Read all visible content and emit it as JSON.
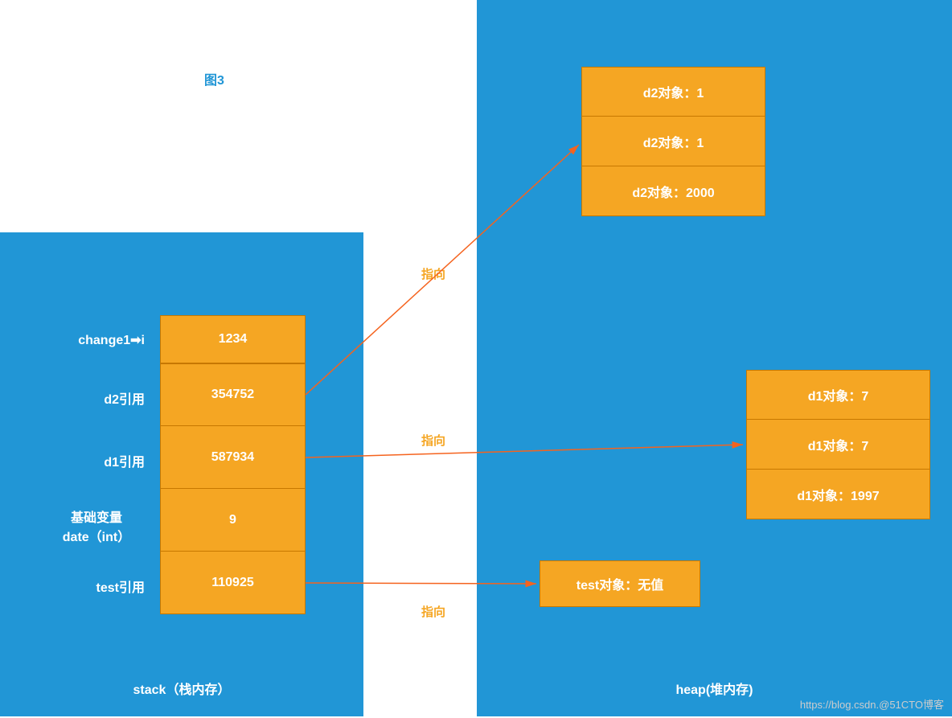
{
  "title": "图3",
  "stack": {
    "panel_label": "stack（栈内存）",
    "rows": [
      {
        "label": "change1➡i",
        "value": "1234"
      },
      {
        "label": "d2引用",
        "value": "354752"
      },
      {
        "label": "d1引用",
        "value": "587934"
      },
      {
        "label": "基础变量\ndate（int）",
        "value": "9"
      },
      {
        "label": "test引用",
        "value": "110925"
      }
    ]
  },
  "heap": {
    "panel_label": "heap(堆内存)",
    "d2_block": [
      "d2对象：1",
      "d2对象：1",
      "d2对象：2000"
    ],
    "d1_block": [
      "d1对象：7",
      "d1对象：7",
      "d1对象：1997"
    ],
    "test_block": "test对象：无值"
  },
  "arrows": {
    "label": "指向"
  },
  "watermark": "https://blog.csdn.@51CTO博客"
}
